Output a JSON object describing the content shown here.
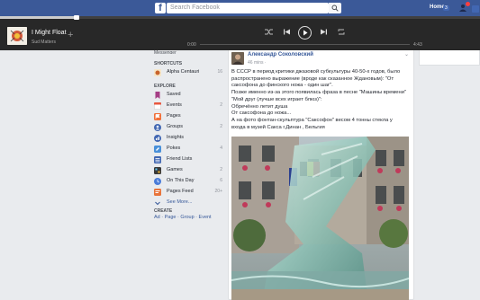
{
  "topbar": {
    "logo": "f",
    "search_placeholder": "Search Facebook",
    "home_label": "Home",
    "home_count": "3"
  },
  "player": {
    "title": "I Might Float",
    "artist": "Sud Matters",
    "add": "+",
    "time_current": "0:00",
    "time_total": "4:43",
    "progress_fraction": 0.16
  },
  "sidebar": {
    "top_partial": "Messenger",
    "shortcuts_heading": "SHORTCUTS",
    "shortcuts": [
      {
        "label": "Alpha Centauri",
        "count": "16",
        "color": "#c8632c"
      }
    ],
    "explore_heading": "EXPLORE",
    "items": [
      {
        "label": "Saved",
        "count": "",
        "icon": "bookmark-icon",
        "color": "#a53e85"
      },
      {
        "label": "Events",
        "count": "2",
        "icon": "calendar-icon",
        "color": "#e9573f"
      },
      {
        "label": "Pages",
        "count": "",
        "icon": "flag-icon",
        "color": "#f1703a"
      },
      {
        "label": "Groups",
        "count": "2",
        "icon": "groups-icon",
        "color": "#4267b2"
      },
      {
        "label": "Insights",
        "count": "",
        "icon": "insights-icon",
        "color": "#4267b2"
      },
      {
        "label": "Pokes",
        "count": "4",
        "icon": "poke-icon",
        "color": "#4a90d9"
      },
      {
        "label": "Friend Lists",
        "count": "",
        "icon": "friend-lists-icon",
        "color": "#4267b2"
      },
      {
        "label": "Games",
        "count": "2",
        "icon": "games-icon",
        "color": "#3a3a3a"
      },
      {
        "label": "On This Day",
        "count": "6",
        "icon": "clock-icon",
        "color": "#4a7cd9"
      },
      {
        "label": "Pages Feed",
        "count": "20+",
        "icon": "pages-feed-icon",
        "color": "#e8743b"
      },
      {
        "label": "See More...",
        "count": "",
        "icon": "chevron-down-icon",
        "color": "#365899"
      }
    ],
    "create_heading": "CREATE",
    "create_links": "Ad · Page · Group · Event"
  },
  "post": {
    "author": "Александр Соколовский",
    "time": "46 mins · ",
    "menu": "⌄",
    "lines": [
      "В СССР в период критики джазовой субкультуры 40-50-х годов, было",
      "распространено выражение (вроде как сказанное Ждановым): \"От",
      "саксофона до финского ножа - один шаг\".",
      "Позже именно из-за этого появилась фраза в песне \"Машины времени\"",
      "\"Мой друг (лучше всех играет блюз)\":",
      "Обречённо летит душа",
      "От саксофона до ножа...",
      "А на фото фонтан-скульптура \"Саксофон\" весом 4 тонны стекла у",
      "входа в музей Сакса г.Динан , Бельгия"
    ]
  }
}
